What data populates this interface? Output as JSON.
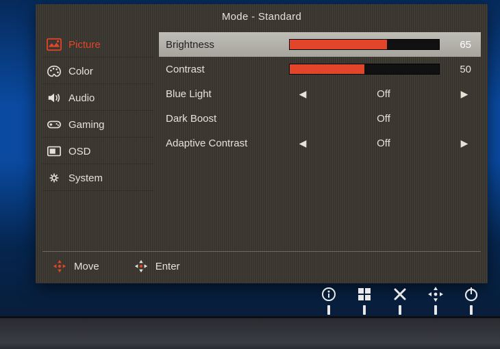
{
  "mode_label": "Mode - Standard",
  "accent": "#e2452a",
  "sidebar": {
    "items": [
      {
        "id": "picture",
        "label": "Picture",
        "icon": "picture-icon",
        "active": true
      },
      {
        "id": "color",
        "label": "Color",
        "icon": "palette-icon"
      },
      {
        "id": "audio",
        "label": "Audio",
        "icon": "speaker-icon"
      },
      {
        "id": "gaming",
        "label": "Gaming",
        "icon": "gamepad-icon"
      },
      {
        "id": "osd",
        "label": "OSD",
        "icon": "osd-icon"
      },
      {
        "id": "system",
        "label": "System",
        "icon": "gear-icon"
      }
    ]
  },
  "settings": [
    {
      "kind": "slider",
      "label": "Brightness",
      "value": 65,
      "max": 100,
      "highlight": true
    },
    {
      "kind": "slider",
      "label": "Contrast",
      "value": 50,
      "max": 100
    },
    {
      "kind": "select",
      "label": "Blue Light",
      "value": "Off",
      "arrows": true
    },
    {
      "kind": "select",
      "label": "Dark Boost",
      "value": "Off",
      "arrows": false
    },
    {
      "kind": "select",
      "label": "Adaptive Contrast",
      "value": "Off",
      "arrows": true
    }
  ],
  "footer": {
    "move": "Move",
    "enter": "Enter"
  },
  "bezel_buttons": [
    "info-icon",
    "grid-icon",
    "close-icon",
    "joystick-icon",
    "power-icon"
  ]
}
